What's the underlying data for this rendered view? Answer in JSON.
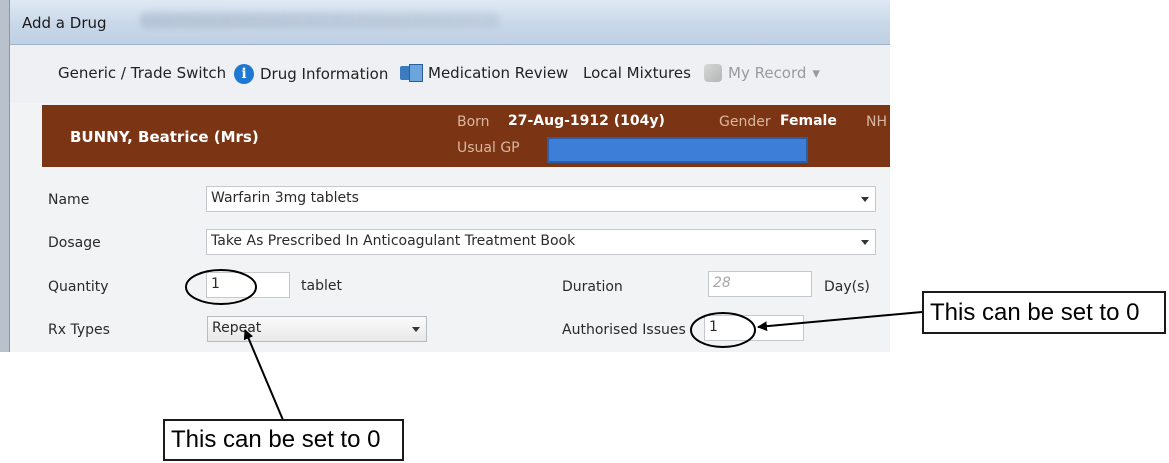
{
  "window": {
    "title": "Add a Drug"
  },
  "toolbar": {
    "generic_trade": "Generic / Trade Switch",
    "drug_information": "Drug Information",
    "medication_review": "Medication Review",
    "local_mixtures": "Local Mixtures",
    "my_record": "My Record",
    "my_record_arrow": "▾"
  },
  "patient": {
    "name": "BUNNY, Beatrice (Mrs)",
    "born_label": "Born",
    "born_value": "27-Aug-1912 (104y)",
    "gender_label": "Gender",
    "gender_value": "Female",
    "nhs_label": "NH",
    "gp_label": "Usual GP"
  },
  "form": {
    "name_label": "Name",
    "name_value": "Warfarin 3mg tablets",
    "dosage_label": "Dosage",
    "dosage_value": "Take As Prescribed In Anticoagulant Treatment Book",
    "quantity_label": "Quantity",
    "quantity_value": "1",
    "quantity_unit": "tablet",
    "duration_label": "Duration",
    "duration_placeholder": "28",
    "duration_unit": "Day(s)",
    "rx_types_label": "Rx Types",
    "rx_types_value": "Repeat",
    "authorised_issues_label": "Authorised Issues",
    "authorised_issues_value": "1"
  },
  "annotations": {
    "note_right": "This can be set to 0",
    "note_bottom": "This can be set to 0"
  }
}
